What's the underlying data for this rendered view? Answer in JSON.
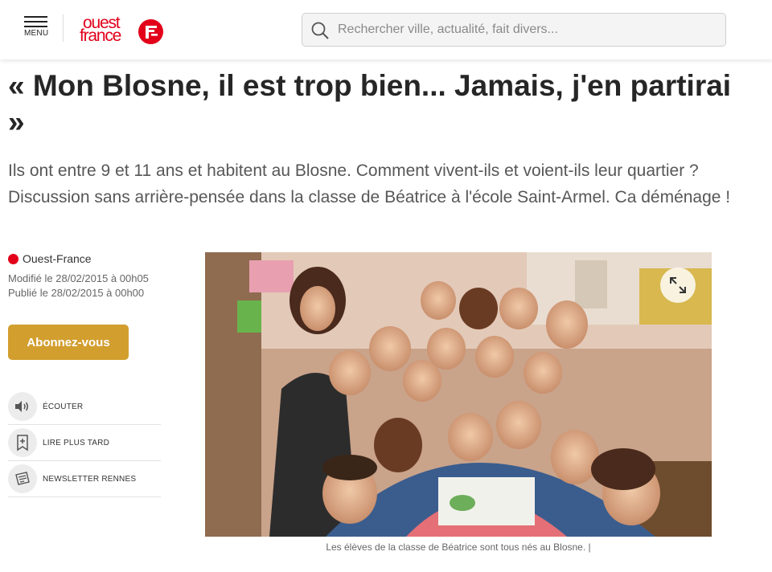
{
  "header": {
    "menu_label": "MENU",
    "logo": {
      "line1": "ouest",
      "line2": "france"
    },
    "search_placeholder": "Rechercher ville, actualité, fait divers..."
  },
  "article": {
    "title": "« Mon Blosne, il est trop bien... Jamais, j'en partirai »",
    "standfirst": "Ils ont entre 9 et 11 ans et habitent au Blosne. Comment vivent-ils et voient-ils leur quartier ? Discussion sans arrière-pensée dans la classe de Béatrice à l'école Saint-Armel. Ca déménage !",
    "source": "Ouest-France",
    "modified": "Modifié le 28/02/2015 à 00h05",
    "published": "Publié le 28/02/2015 à 00h00",
    "subscribe_label": "Abonnez-vous",
    "caption": "Les élèves de la classe de Béatrice sont tous nés au Blosne. |"
  },
  "actions": [
    {
      "label": "ÉCOUTER",
      "icon": "speaker-icon"
    },
    {
      "label": "LIRE PLUS TARD",
      "icon": "bookmark-add-icon"
    },
    {
      "label": "NEWSLETTER RENNES",
      "icon": "newsletter-icon"
    }
  ],
  "colors": {
    "brand_red": "#e2001a",
    "subscribe_gold": "#d29e2e"
  }
}
